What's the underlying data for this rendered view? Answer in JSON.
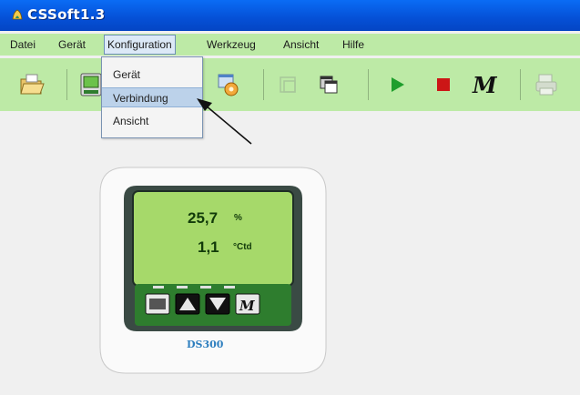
{
  "window": {
    "title": "CSSoft1.3"
  },
  "menu": {
    "items": [
      "Datei",
      "Gerät",
      "Konfiguration",
      "Werkzeug",
      "Ansicht",
      "Hilfe"
    ],
    "active": "Konfiguration"
  },
  "dropdown": {
    "items": [
      "Gerät",
      "Verbindung",
      "Ansicht"
    ],
    "highlighted": "Verbindung"
  },
  "toolbar": {
    "icons": [
      "open-folder-icon",
      "device-icon",
      "config-tool-icon",
      "window-icon",
      "cascade-icon",
      "play-icon",
      "stop-icon",
      "m-logo-icon",
      "printer-icon"
    ]
  },
  "device": {
    "value1": "25,7",
    "unit1": "%",
    "value2": "1,1",
    "unit2": "°Ctd",
    "model": "DS300",
    "colors": {
      "lcd": "#a6d96a",
      "frame": "#2f3f3a",
      "keypad": "#2e7d2e"
    }
  }
}
